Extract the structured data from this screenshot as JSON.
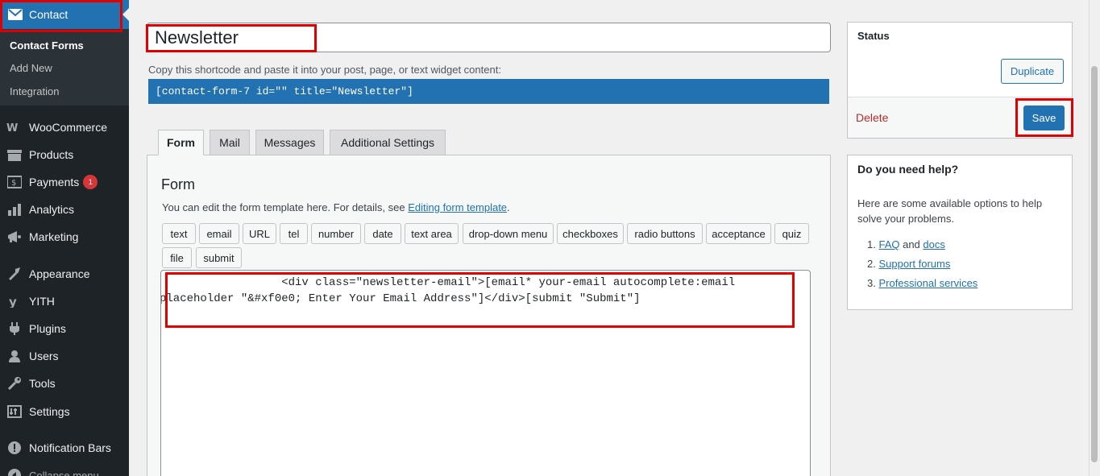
{
  "sidebar": {
    "contact_label": "Contact",
    "submenu": [
      {
        "label": "Contact Forms",
        "current": true
      },
      {
        "label": "Add New",
        "current": false
      },
      {
        "label": "Integration",
        "current": false
      }
    ],
    "items": [
      {
        "label": "WooCommerce",
        "icon": "woocommerce-icon"
      },
      {
        "label": "Products",
        "icon": "products-icon"
      },
      {
        "label": "Payments",
        "icon": "payments-icon",
        "badge": "1"
      },
      {
        "label": "Analytics",
        "icon": "analytics-icon"
      },
      {
        "label": "Marketing",
        "icon": "marketing-icon"
      },
      {
        "label": "Appearance",
        "icon": "appearance-icon"
      },
      {
        "label": "YITH",
        "icon": "yith-icon"
      },
      {
        "label": "Plugins",
        "icon": "plugins-icon"
      },
      {
        "label": "Users",
        "icon": "users-icon"
      },
      {
        "label": "Tools",
        "icon": "tools-icon"
      },
      {
        "label": "Settings",
        "icon": "settings-icon"
      },
      {
        "label": "Notification Bars",
        "icon": "notification-bars-icon"
      },
      {
        "label": "Collapse menu",
        "icon": "collapse-icon"
      }
    ]
  },
  "form": {
    "title_value": "Newsletter",
    "shortcode_label": "Copy this shortcode and paste it into your post, page, or text widget content:",
    "shortcode": "[contact-form-7 id=\"\" title=\"Newsletter\"]",
    "tabs": [
      "Form",
      "Mail",
      "Messages",
      "Additional Settings"
    ],
    "panel_heading": "Form",
    "panel_desc_prefix": "You can edit the form template here. For details, see ",
    "panel_desc_link": "Editing form template",
    "panel_desc_suffix": ".",
    "tag_buttons": [
      "text",
      "email",
      "URL",
      "tel",
      "number",
      "date",
      "text area",
      "drop-down menu",
      "checkboxes",
      "radio buttons",
      "acceptance",
      "quiz",
      "file",
      "submit"
    ],
    "editor_lines": [
      "                  <div class=\"newsletter-email\">[email* your-email autocomplete:email",
      "placeholder \"&#xf0e0; Enter Your Email Address\"]</div>[submit \"Submit\"]"
    ]
  },
  "status": {
    "title": "Status",
    "duplicate_label": "Duplicate",
    "delete_label": "Delete",
    "save_label": "Save"
  },
  "help": {
    "title": "Do you need help?",
    "text": "Here are some available options to help solve your problems.",
    "item1_num": "1.",
    "item1_link1": "FAQ",
    "item1_and": " and ",
    "item1_link2": "docs",
    "item2_num": "2.",
    "item2_link": "Support forums",
    "item3_num": "3.",
    "item3_link": "Professional services"
  },
  "colors": {
    "sidebar_bg": "#1d2327",
    "accent": "#2271b1",
    "highlight": "#e00000",
    "delete": "#b32d2e"
  }
}
